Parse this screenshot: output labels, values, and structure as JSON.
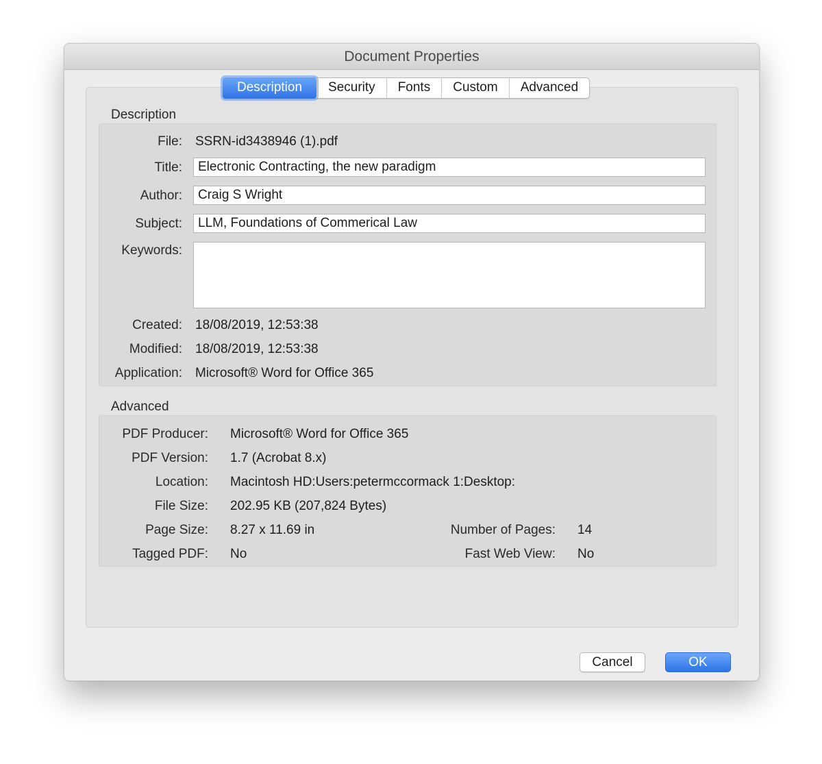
{
  "window": {
    "title": "Document Properties"
  },
  "tabs": [
    {
      "label": "Description",
      "active": true
    },
    {
      "label": "Security",
      "active": false
    },
    {
      "label": "Fonts",
      "active": false
    },
    {
      "label": "Custom",
      "active": false
    },
    {
      "label": "Advanced",
      "active": false
    }
  ],
  "description": {
    "section_label": "Description",
    "file_label": "File:",
    "file_value": "SSRN-id3438946 (1).pdf",
    "title_label": "Title:",
    "title_value": "Electronic Contracting, the new paradigm",
    "author_label": "Author:",
    "author_value": "Craig S Wright",
    "subject_label": "Subject:",
    "subject_value": "LLM, Foundations of Commerical Law",
    "keywords_label": "Keywords:",
    "keywords_value": "",
    "created_label": "Created:",
    "created_value": "18/08/2019, 12:53:38",
    "modified_label": "Modified:",
    "modified_value": "18/08/2019, 12:53:38",
    "application_label": "Application:",
    "application_value": "Microsoft® Word for Office 365"
  },
  "advanced": {
    "section_label": "Advanced",
    "pdf_producer_label": "PDF Producer:",
    "pdf_producer_value": "Microsoft® Word for Office 365",
    "pdf_version_label": "PDF Version:",
    "pdf_version_value": "1.7 (Acrobat 8.x)",
    "location_label": "Location:",
    "location_value": "Macintosh HD:Users:petermccormack 1:Desktop:",
    "file_size_label": "File Size:",
    "file_size_value": "202.95 KB (207,824 Bytes)",
    "page_size_label": "Page Size:",
    "page_size_value": "8.27 x 11.69 in",
    "num_pages_label": "Number of Pages:",
    "num_pages_value": "14",
    "tagged_pdf_label": "Tagged PDF:",
    "tagged_pdf_value": "No",
    "fast_web_view_label": "Fast Web View:",
    "fast_web_view_value": "No"
  },
  "buttons": {
    "cancel_label": "Cancel",
    "ok_label": "OK"
  },
  "colors": {
    "accent": "#2f73e8",
    "window_bg": "#ececec",
    "group_bg": "#dadada"
  }
}
